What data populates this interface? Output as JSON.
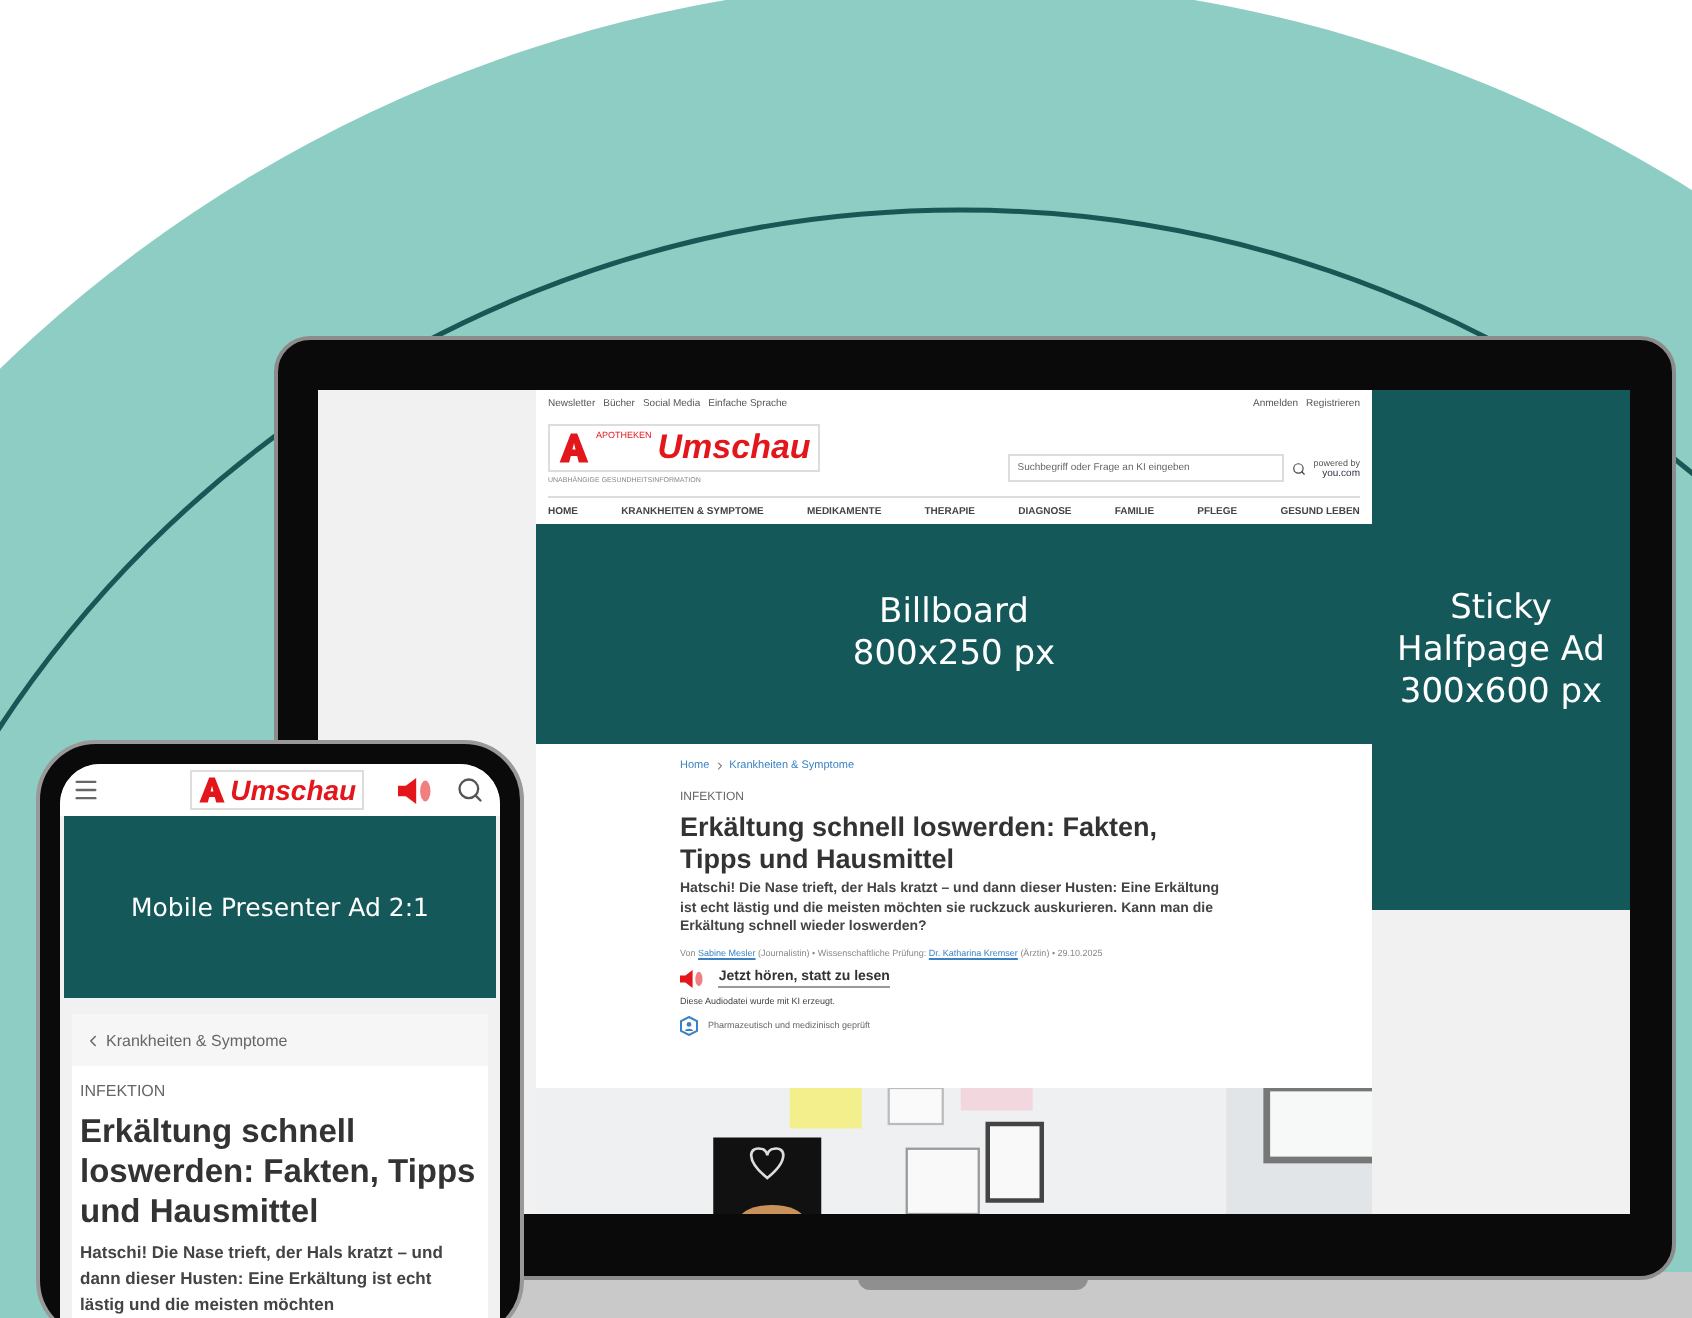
{
  "laptop": {
    "top_links": [
      "Newsletter",
      "Bücher",
      "Social Media",
      "Einfache Sprache"
    ],
    "account_links": [
      "Anmelden",
      "Registrieren"
    ],
    "logo": {
      "small": "APOTHEKEN",
      "name": "Umschau",
      "tagline": "UNABHÄNGIGE GESUNDHEITSINFORMATION"
    },
    "search": {
      "placeholder": "Suchbegriff oder Frage an KI eingeben"
    },
    "powered_by": {
      "label": "powered by",
      "brand": "you.com"
    },
    "nav": [
      "HOME",
      "KRANKHEITEN & SYMPTOME",
      "MEDIKAMENTE",
      "THERAPIE",
      "DIAGNOSE",
      "FAMILIE",
      "PFLEGE",
      "GESUND LEBEN"
    ],
    "billboard": [
      "Billboard",
      "800x250 px"
    ],
    "sticky_ad": [
      "Sticky",
      "Halfpage Ad",
      "300x600 px"
    ],
    "breadcrumb": [
      "Home",
      "Krankheiten & Symptome"
    ],
    "article": {
      "category": "INFEKTION",
      "title": "Erkältung schnell loswerden: Fakten, Tipps und Hausmittel",
      "lead": "Hatschi! Die Nase trieft, der Hals kratzt – und dann dieser Husten: Eine Erkältung ist echt lästig und die meisten möchten sie ruckzuck auskurieren. Kann man die Erkältung schnell wieder loswerden?",
      "byline": [
        {
          "text": "Von "
        },
        {
          "text": "Sabine Mesler",
          "link": true
        },
        {
          "text": " (Journalistin) • Wissenschaftliche Prüfung: "
        },
        {
          "text": "Dr. Katharina Kremser",
          "link": true
        },
        {
          "text": " (Ärztin) • 29.10.2025"
        }
      ],
      "listen": "Jetzt hören, statt zu lesen",
      "ai_note": "Diese Audiodatei wurde mit KI erzeugt.",
      "verified": "Pharmazeutisch und medizinisch geprüft"
    },
    "photo": {
      "kind": "picture"
    }
  },
  "phone": {
    "logo": "Umschau",
    "ad": "Mobile Presenter Ad 2:1",
    "back_link": "Krankheiten & Symptome",
    "category": "INFEKTION",
    "title": "Erkältung schnell loswerden: Fakten, Tipps und Hausmittel",
    "lead": "Hatschi! Die Nase trieft, der Hals kratzt – und dann dieser Husten: Eine Erkältung ist echt lästig und die meisten möchten"
  }
}
